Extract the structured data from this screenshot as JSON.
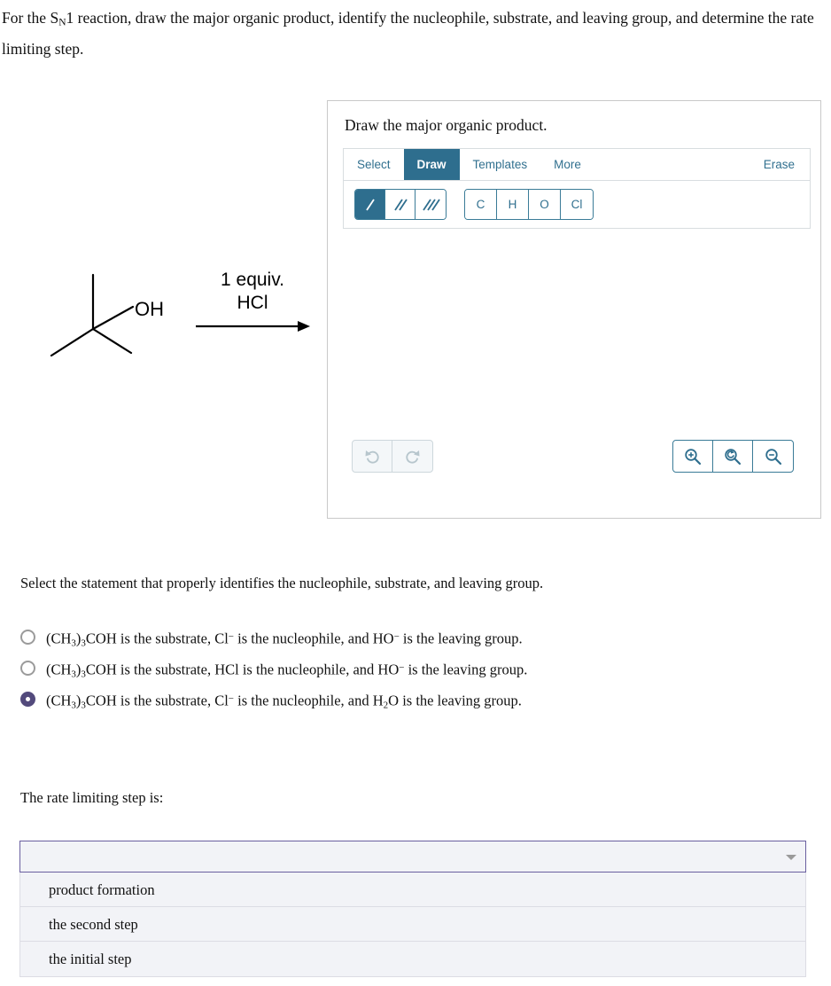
{
  "prompt": {
    "before": "For the S",
    "sub": "N",
    "after": "1 reaction, draw the major organic product, identify the nucleophile, substrate, and leaving group, and determine the rate limiting step."
  },
  "scheme": {
    "reagent": "1 equiv.\nHCl",
    "substrate_label": "OH",
    "substrate_name": "tert-butanol"
  },
  "draw_panel": {
    "title": "Draw the major organic product.",
    "tabs": [
      {
        "label": "Select",
        "active": false
      },
      {
        "label": "Draw",
        "active": true
      },
      {
        "label": "Templates",
        "active": false
      },
      {
        "label": "More",
        "active": false
      }
    ],
    "erase_label": "Erase",
    "bond_tools": [
      {
        "name": "single-bond",
        "active": true
      },
      {
        "name": "double-bond",
        "active": false
      },
      {
        "name": "triple-bond",
        "active": false
      }
    ],
    "atom_tools": [
      "C",
      "H",
      "O",
      "Cl"
    ],
    "history_tools": [
      "undo-icon",
      "redo-icon"
    ],
    "zoom_tools": [
      "zoom-in-icon",
      "zoom-reset-icon",
      "zoom-out-icon"
    ]
  },
  "question_radio": {
    "label": "Select the statement that properly identifies the nucleophile, substrate, and leaving group.",
    "options": [
      {
        "selected": false,
        "parts": [
          {
            "t": "(CH"
          },
          {
            "t": "3",
            "s": "sub"
          },
          {
            "t": ")"
          },
          {
            "t": "3",
            "s": "sub"
          },
          {
            "t": "COH is the substrate, Cl"
          },
          {
            "t": "−",
            "s": "sup"
          },
          {
            "t": " is the nucleophile, and HO"
          },
          {
            "t": "−",
            "s": "sup"
          },
          {
            "t": " is the leaving group."
          }
        ]
      },
      {
        "selected": false,
        "parts": [
          {
            "t": "(CH"
          },
          {
            "t": "3",
            "s": "sub"
          },
          {
            "t": ")"
          },
          {
            "t": "3",
            "s": "sub"
          },
          {
            "t": "COH is the substrate, HCl is the nucleophile, and HO"
          },
          {
            "t": "−",
            "s": "sup"
          },
          {
            "t": " is the leaving group."
          }
        ]
      },
      {
        "selected": true,
        "parts": [
          {
            "t": "(CH"
          },
          {
            "t": "3",
            "s": "sub"
          },
          {
            "t": ")"
          },
          {
            "t": "3",
            "s": "sub"
          },
          {
            "t": "COH is the substrate, Cl"
          },
          {
            "t": "−",
            "s": "sup"
          },
          {
            "t": " is the nucleophile, and H"
          },
          {
            "t": "2",
            "s": "sub"
          },
          {
            "t": "O is the leaving group."
          }
        ]
      }
    ]
  },
  "question_select": {
    "label": "The rate limiting step is:",
    "selected_value": "",
    "options": [
      "product formation",
      "the second step",
      "the initial step"
    ]
  },
  "colors": {
    "accent_teal": "#2e6e8e",
    "radio_selected": "#534a7c",
    "select_border": "#6a5fa0",
    "panel_border": "#c9c9c9"
  }
}
